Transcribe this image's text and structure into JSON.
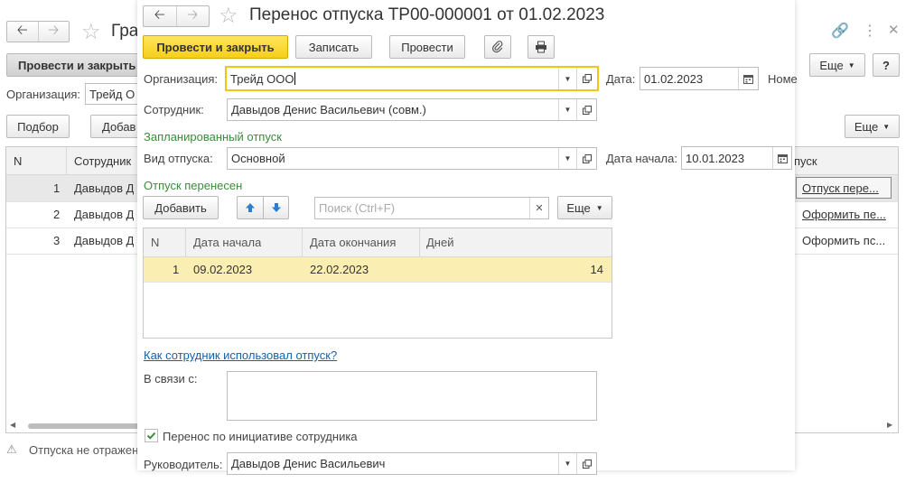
{
  "bg": {
    "title": "Гра",
    "post_close": "Провести и закрыть",
    "org_label": "Организация:",
    "org_value": "Трейд О",
    "pick_btn": "Подбор",
    "add_btn": "Добав",
    "more_btn": "Еще",
    "more_btn2": "Еще",
    "help_btn": "?",
    "col_n": "N",
    "col_emp": "Сотрудник",
    "col_status": "пуск",
    "rows": [
      {
        "n": "1",
        "emp": "Давыдов Д",
        "action": "Отпуск пере..."
      },
      {
        "n": "2",
        "emp": "Давыдов Д",
        "action": "Оформить пе..."
      },
      {
        "n": "3",
        "emp": "Давыдов Д",
        "action": "Оформить пс..."
      }
    ],
    "warning": "Отпуска не отражен"
  },
  "doc": {
    "title": "Перенос отпуска ТР00-000001 от 01.02.2023",
    "toolbar": {
      "post_close": "Провести и закрыть",
      "save": "Записать",
      "post": "Провести"
    },
    "org_label": "Организация:",
    "org_value": "Трейд ООО",
    "date_label": "Дата:",
    "date_value": "01.02.2023",
    "number_label": "Номе",
    "employee_label": "Сотрудник:",
    "employee_value": "Давыдов Денис Васильевич (совм.)",
    "planned_section": "Запланированный отпуск",
    "vac_type_label": "Вид отпуска:",
    "vac_type_value": "Основной",
    "start_label": "Дата начала:",
    "start_value": "10.01.2023",
    "moved_section": "Отпуск перенесен",
    "add_btn": "Добавить",
    "search_placeholder": "Поиск (Ctrl+F)",
    "more_btn": "Еще",
    "table": {
      "headers": [
        "N",
        "Дата начала",
        "Дата окончания",
        "Дней"
      ],
      "rows": [
        {
          "n": "1",
          "start": "09.02.2023",
          "end": "22.02.2023",
          "days": "14"
        }
      ]
    },
    "how_used_link": "Как сотрудник использовал отпуск?",
    "reason_label": "В связи с:",
    "reason_value": "",
    "initiative_label": "Перенос по инициативе сотрудника",
    "initiative_checked": true,
    "manager_label": "Руководитель:",
    "manager_value": "Давыдов Денис Васильевич"
  },
  "colors": {
    "accent_yellow": "#f5cf1c",
    "section_green": "#3b8c3b",
    "selected_row": "#fbeeb2",
    "link_blue": "#1a5fa8"
  }
}
